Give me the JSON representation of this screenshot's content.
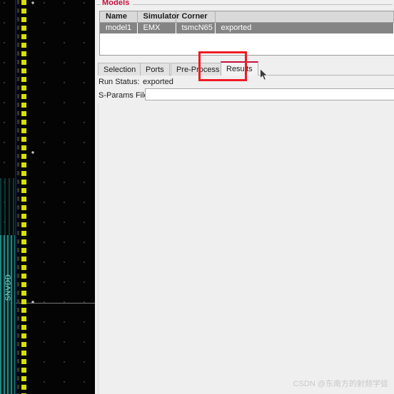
{
  "layout_canvas": {
    "net_label": "SNVDD",
    "colors": {
      "background": "#040404",
      "power_rail": "#d8e000",
      "metal_stack": "#1f8f8a",
      "guide_line": "#8d8d8d"
    }
  },
  "dialog": {
    "models_group": {
      "title": "Models",
      "table": {
        "columns": [
          "Name",
          "Simulator",
          "Corner",
          ""
        ],
        "rows": [
          {
            "name": "model1",
            "simulator": "EMX",
            "corner": "tsmcN65",
            "status": "exported",
            "selected": true
          }
        ]
      }
    },
    "tabs": [
      {
        "label": "Selection",
        "active": false
      },
      {
        "label": "Ports",
        "active": false
      },
      {
        "label": "Pre-Process",
        "active": false
      },
      {
        "label": "Results",
        "active": true
      }
    ],
    "results_panel": {
      "run_status_label": "Run Status:",
      "run_status_value": "exported",
      "sparams_label": "S-Params File:",
      "sparams_value": "",
      "sparams_placeholder": ""
    }
  },
  "annotation": {
    "highlight_color": "#ee1b24",
    "target": "Results"
  },
  "watermark": {
    "text": "CSDN @东南方的射频学徒"
  }
}
